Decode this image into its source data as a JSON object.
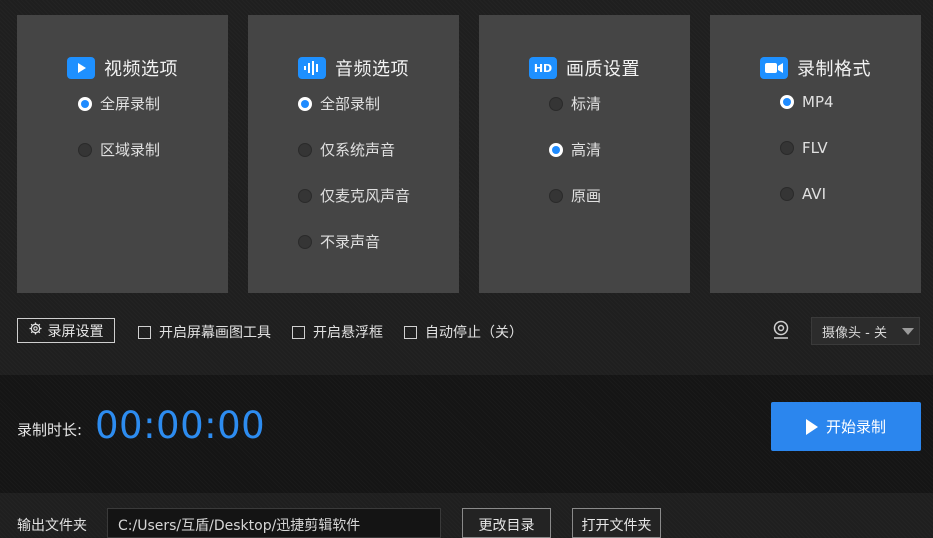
{
  "colors": {
    "accent": "#2b86ee",
    "panel": "#454545",
    "timer": "#2d8cf0"
  },
  "panels": [
    {
      "title": "视频选项",
      "icon": "video-play-icon",
      "options": [
        {
          "label": "全屏录制",
          "checked": true
        },
        {
          "label": "区域录制",
          "checked": false
        }
      ]
    },
    {
      "title": "音频选项",
      "icon": "audio-wave-icon",
      "options": [
        {
          "label": "全部录制",
          "checked": true
        },
        {
          "label": "仅系统声音",
          "checked": false
        },
        {
          "label": "仅麦克风声音",
          "checked": false
        },
        {
          "label": "不录声音",
          "checked": false
        }
      ]
    },
    {
      "title": "画质设置",
      "icon": "hd-icon",
      "icon_text": "HD",
      "options": [
        {
          "label": "标清",
          "checked": false
        },
        {
          "label": "高清",
          "checked": true
        },
        {
          "label": "原画",
          "checked": false
        }
      ]
    },
    {
      "title": "录制格式",
      "icon": "camera-icon",
      "options": [
        {
          "label": "MP4",
          "checked": true
        },
        {
          "label": "FLV",
          "checked": false
        },
        {
          "label": "AVI",
          "checked": false
        }
      ]
    }
  ],
  "toolbar": {
    "settings_label": "录屏设置",
    "checks": [
      {
        "label": "开启屏幕画图工具",
        "checked": false
      },
      {
        "label": "开启悬浮框",
        "checked": false
      },
      {
        "label": "自动停止（关）",
        "checked": false
      }
    ],
    "camera_select": "摄像头 - 关"
  },
  "recording": {
    "duration_label": "录制时长:",
    "timer": "00:00:00",
    "start_label": "开始录制"
  },
  "output": {
    "label": "输出文件夹",
    "path": "C:/Users/互盾/Desktop/迅捷剪辑软件",
    "change_dir_label": "更改目录",
    "open_folder_label": "打开文件夹"
  }
}
